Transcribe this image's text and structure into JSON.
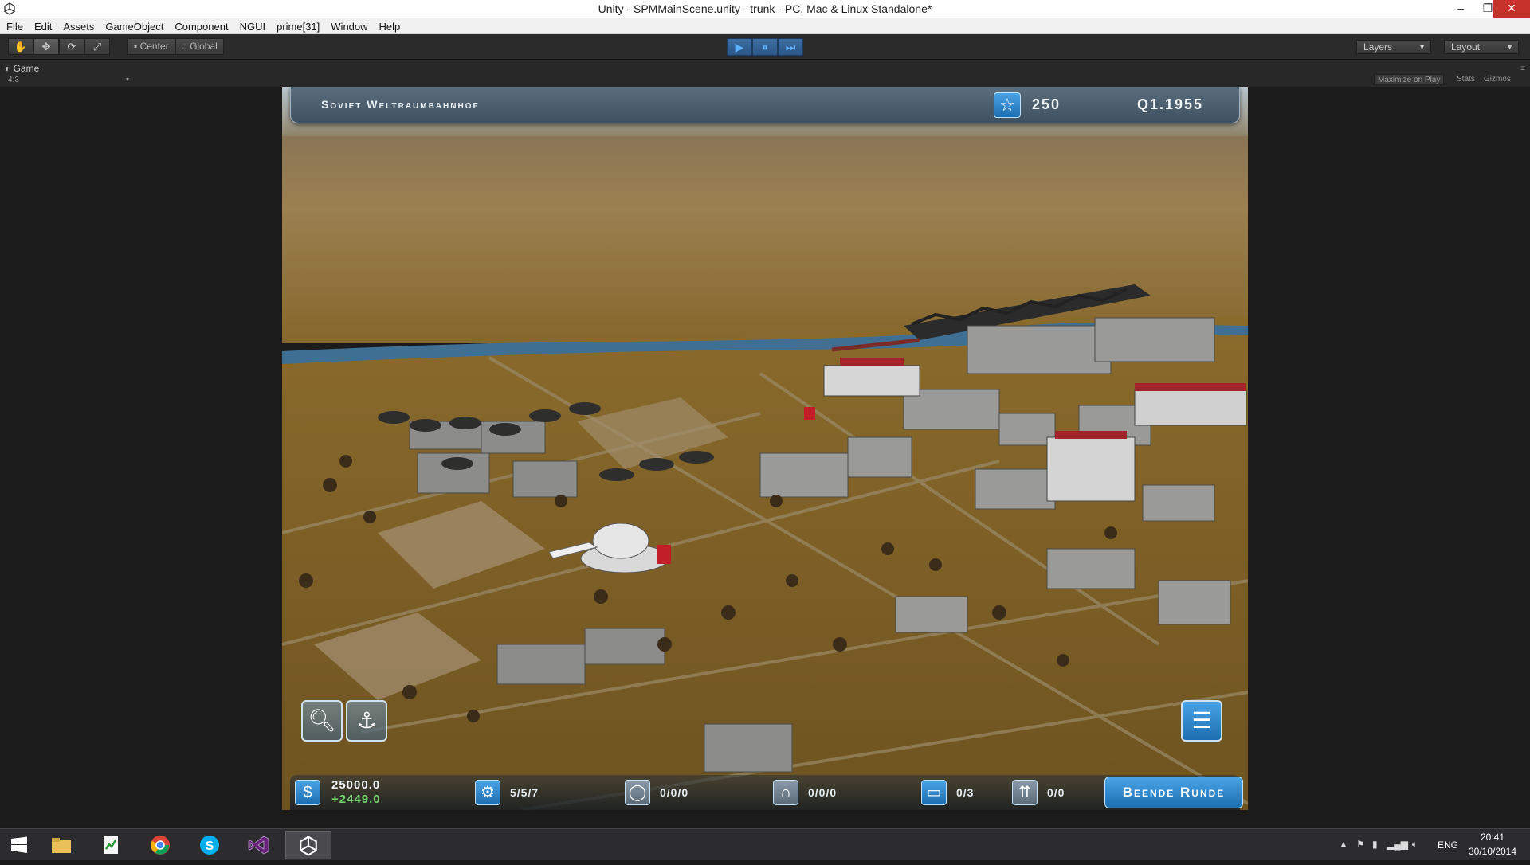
{
  "window": {
    "title": "Unity - SPMMainScene.unity - trunk - PC, Mac & Linux Standalone*",
    "minimize": "–",
    "restore": "❐",
    "close": "✕"
  },
  "menu": [
    "File",
    "Edit",
    "Assets",
    "GameObject",
    "Component",
    "NGUI",
    "prime[31]",
    "Window",
    "Help"
  ],
  "toolbar": {
    "tools": [
      {
        "name": "hand-tool",
        "glyph": "✋"
      },
      {
        "name": "move-tool",
        "glyph": "✥"
      },
      {
        "name": "rotate-tool",
        "glyph": "⟳"
      },
      {
        "name": "scale-tool",
        "glyph": "⤢"
      }
    ],
    "pivot_center": "Center",
    "pivot_global": "Global",
    "play": "▶",
    "pause": "⏸",
    "step": "⏭",
    "layers": "Layers",
    "layout": "Layout"
  },
  "game_panel": {
    "tab": "Game",
    "aspect": "4:3",
    "maximize_on_play": "Maximize on Play",
    "stats": "Stats",
    "gizmos": "Gizmos"
  },
  "hud": {
    "station_name": "Soviet Weltraumbahnhof",
    "stars": "250",
    "quarter": "Q1.1955",
    "money": "25000.0",
    "income": "+2449.0",
    "engineers": "5/5/7",
    "stat_2": "0/0/0",
    "stat_3": "0/0/0",
    "stat_4": "0/3",
    "stat_5": "0/0",
    "end_round": "Beende Runde"
  },
  "taskbar": {
    "language": "ENG",
    "time": "20:41",
    "date": "30/10/2014"
  }
}
